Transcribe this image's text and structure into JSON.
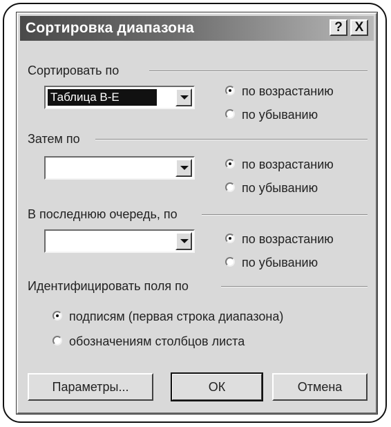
{
  "dialog": {
    "title": "Сортировка диапазона",
    "help_label": "?",
    "close_label": "X"
  },
  "sort_by": {
    "label": "Сортировать по",
    "combo_value": "Таблица B-E",
    "asc_label": "по возрастанию",
    "desc_label": "по убыванию",
    "selected": "asc"
  },
  "then_by": {
    "label": "Затем по",
    "combo_value": "",
    "asc_label": "по возрастанию",
    "desc_label": "по убыванию",
    "selected": "asc"
  },
  "last_by": {
    "label": "В последнюю очередь, по",
    "combo_value": "",
    "asc_label": "по возрастанию",
    "desc_label": "по убыванию",
    "selected": "asc"
  },
  "identify": {
    "label": "Идентифицировать поля по",
    "option_headers": "подписям (первая строка диапазона)",
    "option_columns": "обозначениям столбцов листа",
    "selected": "headers"
  },
  "buttons": {
    "params": "Параметры...",
    "ok": "ОК",
    "cancel": "Отмена"
  },
  "colors": {
    "dialog_bg": "#d9d9d9",
    "titlebar_dark": "#4a4a4a",
    "titlebar_light": "#b9b9b9"
  }
}
